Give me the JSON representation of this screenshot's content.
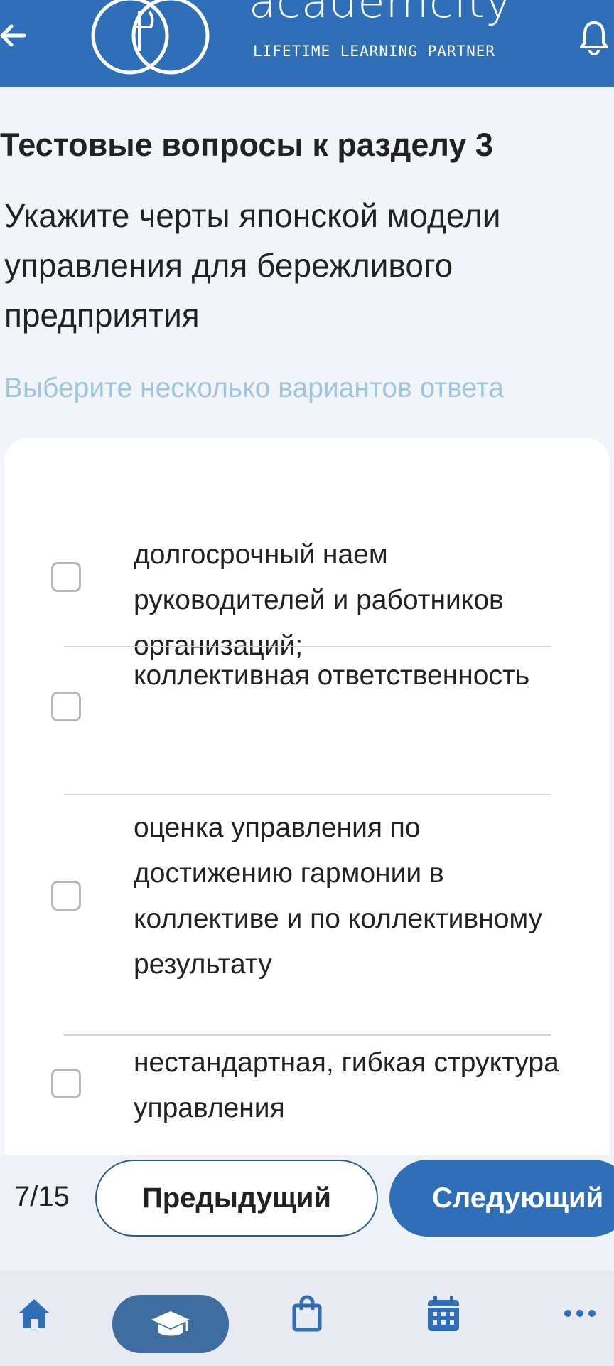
{
  "header": {
    "brand": "academcity",
    "tagline": "LIFETIME LEARNING PARTNER",
    "back_icon": "arrow-left-icon",
    "bell_icon": "bell-icon",
    "color": "#2e6fb7"
  },
  "section_title": "Тестовые вопросы к разделу 3",
  "question": "Укажите черты японской модели управления для бережливого предприятия",
  "hint": "Выберите несколько вариантов ответа",
  "options": [
    {
      "label": "долгосрочный наем руководителей и работников организаций;",
      "checked": false
    },
    {
      "label": "коллективная ответственность",
      "checked": false
    },
    {
      "label": "оценка управления по достижению гармонии в коллективе и по коллективному результату",
      "checked": false
    },
    {
      "label": "нестандартная, гибкая структура управления",
      "checked": false
    }
  ],
  "pager": {
    "counter": "7/15",
    "prev_label": "Предыдущий",
    "next_label": "Следующий"
  },
  "bottom_nav": [
    {
      "icon": "home-icon",
      "active": false
    },
    {
      "icon": "graduation-cap-icon",
      "active": true
    },
    {
      "icon": "shopping-bag-icon",
      "active": false
    },
    {
      "icon": "calendar-icon",
      "active": false
    },
    {
      "icon": "more-icon",
      "active": false
    }
  ]
}
